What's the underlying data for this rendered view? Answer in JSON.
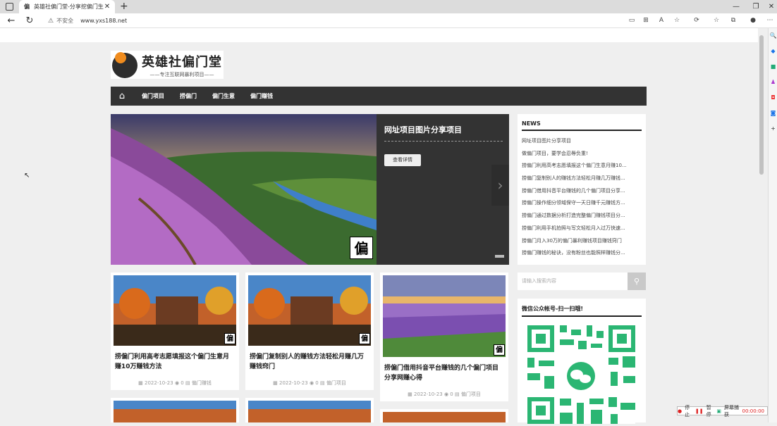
{
  "browser": {
    "tab_title": "英雄社偏门堂-分享挖偏门生意和",
    "tab_favicon": "偏",
    "not_secure": "不安全",
    "url": "www.yxs188.net"
  },
  "site": {
    "logo_title": "英雄社偏门堂",
    "logo_slogan": "——专注互联网暴利项目——",
    "nav": [
      "偏门项目",
      "捞偏门",
      "偏门生意",
      "偏门赚钱"
    ]
  },
  "slider": {
    "caption": "网址项目图片分享项目",
    "button": "查看详情",
    "watermark": "偏"
  },
  "news": {
    "heading": "NEWS",
    "items": [
      "网址项目图片分享项目",
      "做偏门项目，要学会忍辱负重!",
      "捞偏门利用高考志愿填报这个偏门生意月赚10...",
      "捞偏门复制别人的赚钱方法轻松月赚几万赚钱...",
      "捞偏门借用抖音平台赚钱的几个偏门项目分享...",
      "捞偏门操作细分领域保守一天日赚千元赚钱方...",
      "捞偏门通过数据分析打造完整偏门赚钱项目分...",
      "捞偏门利用手机拍照与写文轻松月入过万快速...",
      "捞偏门月入30万的偏门暴利赚钱项目赚钱窍门",
      "捞偏门赚钱的秘诀，没有粉丝也能照样赚钱分..."
    ]
  },
  "search": {
    "placeholder": "请输入搜索内容"
  },
  "wechat": {
    "heading": "微信公众帐号-扫一扫哦!"
  },
  "cards": [
    {
      "title": "捞偏门利用高考志愿填报这个偏门生意月赚10万赚钱方法",
      "date": "2022-10-23",
      "views": "0",
      "category": "偏门赚钱"
    },
    {
      "title": "捞偏门复制别人的赚钱方法轻松月赚几万赚钱窍门",
      "date": "2022-10-23",
      "views": "0",
      "category": "偏门项目"
    },
    {
      "title": "捞偏门借用抖音平台赚钱的几个偏门项目分享网赚心得",
      "date": "2022-10-23",
      "views": "0",
      "category": "偏门项目"
    }
  ],
  "statusbar": {
    "stop": "停止",
    "pause": "暂停",
    "capture": "屏幕捕获",
    "time": "00:00:00"
  },
  "colors": {
    "nav_bg": "#333333",
    "accent_orange": "#f08c1e",
    "qr_green": "#2bb673"
  }
}
